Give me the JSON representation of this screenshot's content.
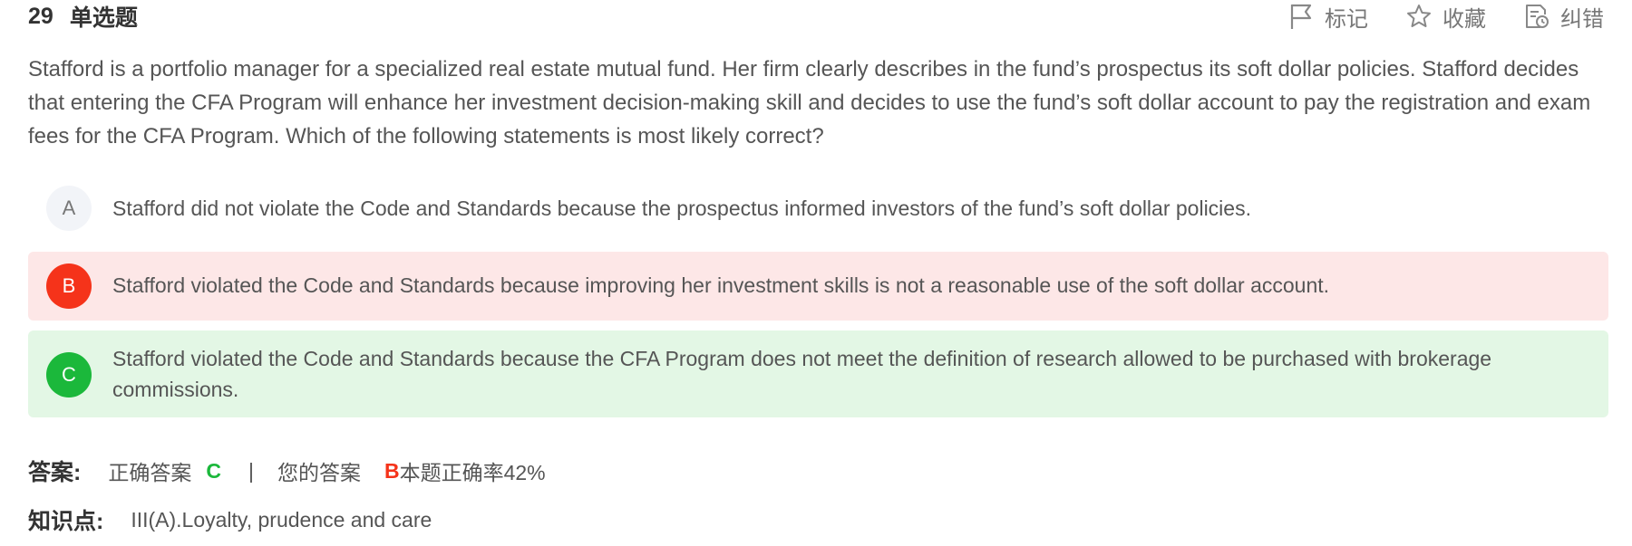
{
  "question": {
    "number": "29",
    "type": "单选题",
    "stem": "Stafford is a portfolio manager for a specialized real estate mutual fund. Her firm clearly describes in the fund’s prospectus its soft dollar policies. Stafford decides that entering the CFA Program will enhance her investment decision-making skill and decides to use the fund’s soft dollar account to pay the registration and exam fees for the CFA Program. Which of the following statements is most likely correct?"
  },
  "actions": {
    "mark_label": "标记",
    "favorite_label": "收藏",
    "report_error_label": "纠错",
    "mark_icon": "flag-icon",
    "favorite_icon": "star-icon",
    "report_error_icon": "document-clock-icon"
  },
  "options": [
    {
      "letter": "A",
      "text": "Stafford did not violate the Code and Standards because the prospectus informed investors of the fund’s soft dollar policies.",
      "state": "neutral"
    },
    {
      "letter": "B",
      "text": "Stafford violated the Code and Standards because improving her investment skills is not a reasonable use of the soft dollar account.",
      "state": "user-wrong"
    },
    {
      "letter": "C",
      "text": "Stafford violated the Code and Standards because the CFA Program does not meet the definition of research allowed to be purchased with brokerage commissions.",
      "state": "correct"
    }
  ],
  "answer": {
    "label": "答案:",
    "correct_prefix": "正确答案",
    "correct_letter": "C",
    "separator": "|",
    "your_prefix": "您的答案",
    "your_letter": "B",
    "accuracy_text": "本题正确率42%"
  },
  "knowledge_point": {
    "label": "知识点:",
    "value": "III(A).Loyalty, prudence and care"
  },
  "colors": {
    "wrong": "#f5331a",
    "correct": "#1bb83b",
    "wrong_bg": "#fde7e7",
    "correct_bg": "#e3f7e5"
  }
}
